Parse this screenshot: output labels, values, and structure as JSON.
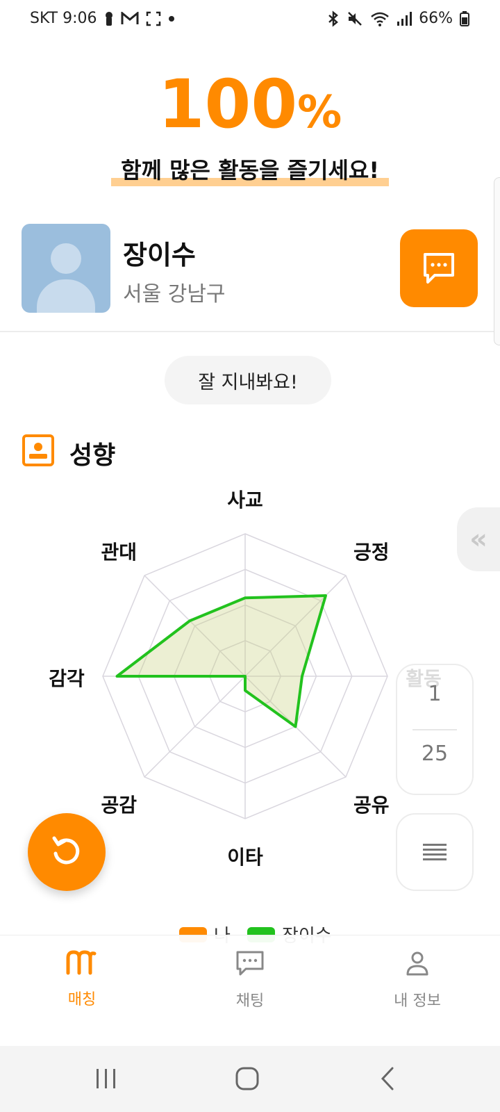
{
  "status_bar": {
    "carrier_time": "SKT 9:06",
    "battery": "66%"
  },
  "match": {
    "percent_value": "100",
    "percent_symbol": "%",
    "tagline": "함께 많은 활동을 즐기세요!"
  },
  "profile": {
    "name": "장이수",
    "location": "서울 강남구"
  },
  "greeting": "잘 지내봐요!",
  "section": {
    "title": "성향"
  },
  "radar": {
    "axes": [
      "사교",
      "긍정",
      "활동",
      "공유",
      "이타",
      "공감",
      "감각",
      "관대"
    ],
    "series": [
      {
        "name": "나",
        "color": "#ff8a00"
      },
      {
        "name": "장이수",
        "color": "#22c21e",
        "values": [
          0.55,
          0.8,
          0.4,
          0.5,
          0.1,
          0.0,
          0.9,
          0.55
        ]
      }
    ]
  },
  "pager": {
    "current": "1",
    "total": "25"
  },
  "collapse_glyph": "«",
  "nav": {
    "items": [
      {
        "label": "매칭"
      },
      {
        "label": "채팅"
      },
      {
        "label": "내 정보"
      }
    ]
  },
  "colors": {
    "accent": "#ff8a00",
    "partner": "#22c21e"
  }
}
